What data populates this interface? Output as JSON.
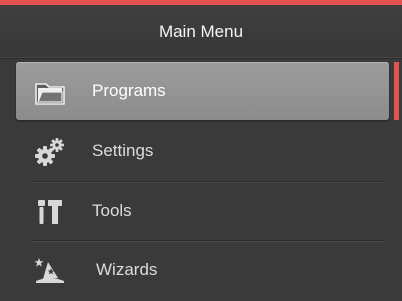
{
  "header": {
    "title": "Main Menu"
  },
  "menu": {
    "items": [
      {
        "label": "Programs",
        "icon": "folder-icon",
        "selected": true
      },
      {
        "label": "Settings",
        "icon": "gears-icon",
        "selected": false
      },
      {
        "label": "Tools",
        "icon": "tools-icon",
        "selected": false
      },
      {
        "label": "Wizards",
        "icon": "wizard-hat-icon",
        "selected": false
      }
    ]
  },
  "colors": {
    "accent": "#e3534f",
    "background": "#3a3a3a",
    "selected_item": "#969696",
    "text": "#dcdcdc"
  }
}
